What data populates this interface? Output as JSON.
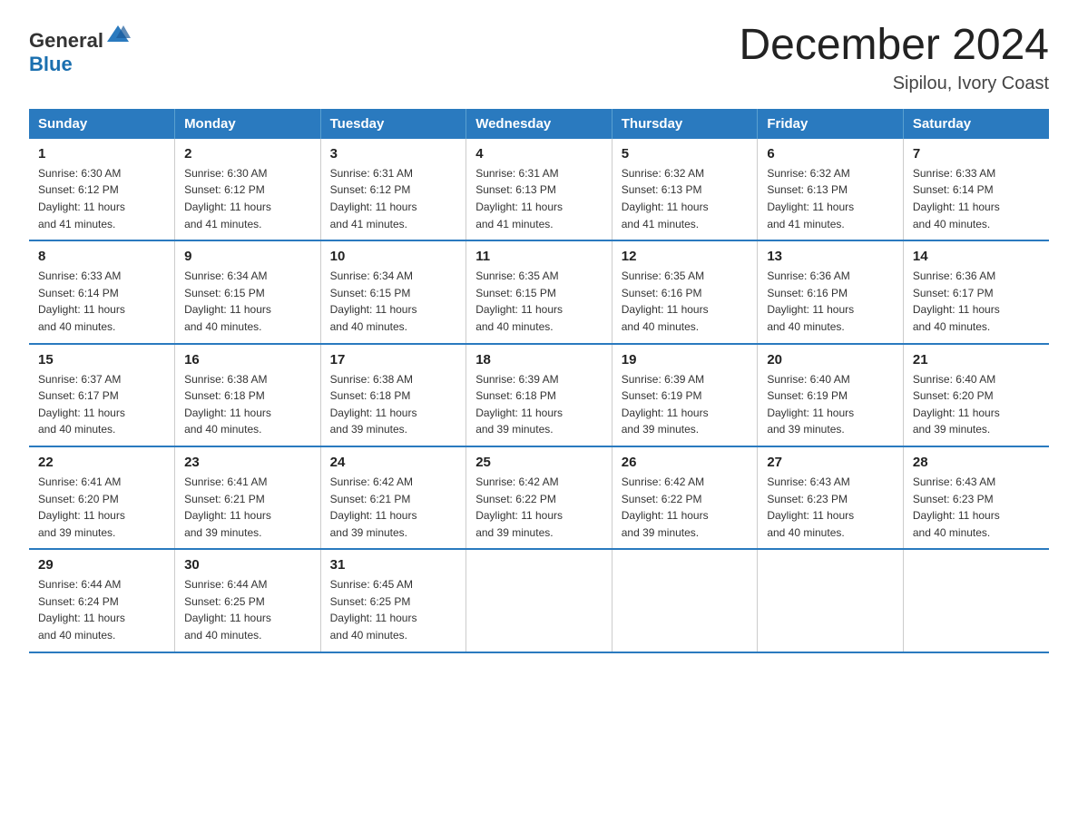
{
  "header": {
    "logo_general": "General",
    "logo_blue": "Blue",
    "month_title": "December 2024",
    "location": "Sipilou, Ivory Coast"
  },
  "days_of_week": [
    "Sunday",
    "Monday",
    "Tuesday",
    "Wednesday",
    "Thursday",
    "Friday",
    "Saturday"
  ],
  "weeks": [
    [
      {
        "day": "1",
        "sunrise": "6:30 AM",
        "sunset": "6:12 PM",
        "daylight": "11 hours and 41 minutes."
      },
      {
        "day": "2",
        "sunrise": "6:30 AM",
        "sunset": "6:12 PM",
        "daylight": "11 hours and 41 minutes."
      },
      {
        "day": "3",
        "sunrise": "6:31 AM",
        "sunset": "6:12 PM",
        "daylight": "11 hours and 41 minutes."
      },
      {
        "day": "4",
        "sunrise": "6:31 AM",
        "sunset": "6:13 PM",
        "daylight": "11 hours and 41 minutes."
      },
      {
        "day": "5",
        "sunrise": "6:32 AM",
        "sunset": "6:13 PM",
        "daylight": "11 hours and 41 minutes."
      },
      {
        "day": "6",
        "sunrise": "6:32 AM",
        "sunset": "6:13 PM",
        "daylight": "11 hours and 41 minutes."
      },
      {
        "day": "7",
        "sunrise": "6:33 AM",
        "sunset": "6:14 PM",
        "daylight": "11 hours and 40 minutes."
      }
    ],
    [
      {
        "day": "8",
        "sunrise": "6:33 AM",
        "sunset": "6:14 PM",
        "daylight": "11 hours and 40 minutes."
      },
      {
        "day": "9",
        "sunrise": "6:34 AM",
        "sunset": "6:15 PM",
        "daylight": "11 hours and 40 minutes."
      },
      {
        "day": "10",
        "sunrise": "6:34 AM",
        "sunset": "6:15 PM",
        "daylight": "11 hours and 40 minutes."
      },
      {
        "day": "11",
        "sunrise": "6:35 AM",
        "sunset": "6:15 PM",
        "daylight": "11 hours and 40 minutes."
      },
      {
        "day": "12",
        "sunrise": "6:35 AM",
        "sunset": "6:16 PM",
        "daylight": "11 hours and 40 minutes."
      },
      {
        "day": "13",
        "sunrise": "6:36 AM",
        "sunset": "6:16 PM",
        "daylight": "11 hours and 40 minutes."
      },
      {
        "day": "14",
        "sunrise": "6:36 AM",
        "sunset": "6:17 PM",
        "daylight": "11 hours and 40 minutes."
      }
    ],
    [
      {
        "day": "15",
        "sunrise": "6:37 AM",
        "sunset": "6:17 PM",
        "daylight": "11 hours and 40 minutes."
      },
      {
        "day": "16",
        "sunrise": "6:38 AM",
        "sunset": "6:18 PM",
        "daylight": "11 hours and 40 minutes."
      },
      {
        "day": "17",
        "sunrise": "6:38 AM",
        "sunset": "6:18 PM",
        "daylight": "11 hours and 39 minutes."
      },
      {
        "day": "18",
        "sunrise": "6:39 AM",
        "sunset": "6:18 PM",
        "daylight": "11 hours and 39 minutes."
      },
      {
        "day": "19",
        "sunrise": "6:39 AM",
        "sunset": "6:19 PM",
        "daylight": "11 hours and 39 minutes."
      },
      {
        "day": "20",
        "sunrise": "6:40 AM",
        "sunset": "6:19 PM",
        "daylight": "11 hours and 39 minutes."
      },
      {
        "day": "21",
        "sunrise": "6:40 AM",
        "sunset": "6:20 PM",
        "daylight": "11 hours and 39 minutes."
      }
    ],
    [
      {
        "day": "22",
        "sunrise": "6:41 AM",
        "sunset": "6:20 PM",
        "daylight": "11 hours and 39 minutes."
      },
      {
        "day": "23",
        "sunrise": "6:41 AM",
        "sunset": "6:21 PM",
        "daylight": "11 hours and 39 minutes."
      },
      {
        "day": "24",
        "sunrise": "6:42 AM",
        "sunset": "6:21 PM",
        "daylight": "11 hours and 39 minutes."
      },
      {
        "day": "25",
        "sunrise": "6:42 AM",
        "sunset": "6:22 PM",
        "daylight": "11 hours and 39 minutes."
      },
      {
        "day": "26",
        "sunrise": "6:42 AM",
        "sunset": "6:22 PM",
        "daylight": "11 hours and 39 minutes."
      },
      {
        "day": "27",
        "sunrise": "6:43 AM",
        "sunset": "6:23 PM",
        "daylight": "11 hours and 40 minutes."
      },
      {
        "day": "28",
        "sunrise": "6:43 AM",
        "sunset": "6:23 PM",
        "daylight": "11 hours and 40 minutes."
      }
    ],
    [
      {
        "day": "29",
        "sunrise": "6:44 AM",
        "sunset": "6:24 PM",
        "daylight": "11 hours and 40 minutes."
      },
      {
        "day": "30",
        "sunrise": "6:44 AM",
        "sunset": "6:25 PM",
        "daylight": "11 hours and 40 minutes."
      },
      {
        "day": "31",
        "sunrise": "6:45 AM",
        "sunset": "6:25 PM",
        "daylight": "11 hours and 40 minutes."
      },
      null,
      null,
      null,
      null
    ]
  ],
  "labels": {
    "sunrise": "Sunrise:",
    "sunset": "Sunset:",
    "daylight": "Daylight:"
  }
}
